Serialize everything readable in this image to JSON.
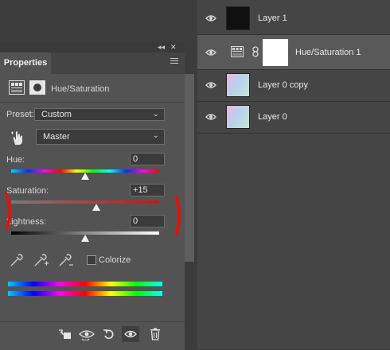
{
  "layers": [
    {
      "name": "Layer 1",
      "thumb": "#101010",
      "eye_icon": "eye-icon"
    },
    {
      "name": "Hue/Saturation 1",
      "thumb": "#ffffff",
      "eye_icon": "eye-icon",
      "selected": true,
      "adjustment_icon": "hue-saturation-adjustment-icon",
      "link_icon": "chain-link-icon"
    },
    {
      "name": "Layer 0 copy",
      "thumb": "gradient",
      "eye_icon": "eye-icon"
    },
    {
      "name": "Layer 0",
      "thumb": "gradient",
      "eye_icon": "eye-icon"
    }
  ],
  "properties": {
    "tab_label": "Properties",
    "collapse_icon": "double-chevron-icon",
    "menu_icon": "hamburger-menu-icon",
    "adjustment_title": "Hue/Saturation",
    "preset_label": "Preset:",
    "preset_value": "Custom",
    "channel_value": "Master",
    "hue_label": "Hue:",
    "hue_value": "0",
    "hue_level": 0,
    "saturation_label": "Saturation:",
    "saturation_value": "+15",
    "saturation_level": 15,
    "lightness_label": "Lightness:",
    "lightness_value": "0",
    "lightness_level": 0,
    "colorize_label": "Colorize",
    "colorize_checked": false
  },
  "bottom_toolbar": [
    "clip-to-layer-icon",
    "view-previous-state-icon",
    "reset-icon",
    "visibility-eye-icon",
    "trash-icon"
  ],
  "colors": {
    "annotation_red": "#e51010",
    "selected_row": "#595959",
    "panel_bg": "#535353"
  }
}
